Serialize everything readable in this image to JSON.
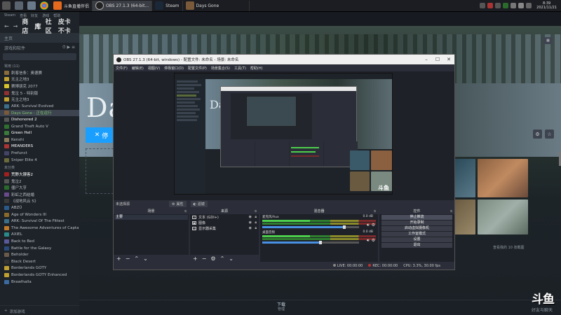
{
  "taskbar": {
    "tasks": [
      {
        "label": "斗鱼直播伴侣",
        "color": "#e56a1d"
      },
      {
        "label": "OBS 27.1.3 (64-bit...",
        "color": "#444",
        "active": true
      },
      {
        "label": "Steam",
        "color": "#1b2838"
      },
      {
        "label": "Days Gone",
        "color": "#7a5a3a"
      }
    ],
    "clock_time": "8:39",
    "clock_date": "2021/11/21"
  },
  "steam": {
    "menu": [
      "Steam",
      "查看",
      "好友",
      "游戏",
      "帮助"
    ],
    "nav": [
      "商店",
      "库",
      "社区",
      "皮卡不卡"
    ],
    "home_label": "主页",
    "filter_label": "游戏和软件",
    "categories": [
      {
        "name": "常用 (11)",
        "games": [
          {
            "name": "刺客信条：奥德赛",
            "color": "#8a6d3b"
          },
          {
            "name": "无主之地3",
            "color": "#c0a030"
          },
          {
            "name": "赛博朋克 2077",
            "color": "#d6c22c"
          },
          {
            "name": "鬼泣 5 - 特别版",
            "color": "#903030"
          },
          {
            "name": "无主之地3",
            "color": "#c0a030"
          },
          {
            "name": "ARK: Survival Evolved",
            "color": "#3c6e8a"
          },
          {
            "name": "Days Gone - 正在运行",
            "color": "#7a5a3a",
            "selected": true
          },
          {
            "name": "Dishonored 2",
            "color": "#555",
            "bright": true
          },
          {
            "name": "Grand Theft Auto V",
            "color": "#2f6e2f"
          },
          {
            "name": "Green Hell",
            "color": "#3a7a3a",
            "bright": true
          },
          {
            "name": "Kenshi",
            "color": "#8a7a5a"
          },
          {
            "name": "MEANDERS",
            "color": "#a33",
            "bright": true
          },
          {
            "name": "Prefunct",
            "color": "#446"
          },
          {
            "name": "Sniper Elite 4",
            "color": "#6a6a3a"
          }
        ]
      },
      {
        "name": "未分类",
        "games": [
          {
            "name": "荒野大镖客2",
            "color": "#a02020",
            "bright": true
          },
          {
            "name": "鬼泣2",
            "color": "#555"
          },
          {
            "name": "僵尸大亨",
            "color": "#2a6a2a"
          },
          {
            "name": "彩虹之西结婚",
            "color": "#6a4a8a"
          },
          {
            "name": "《战地风云 5》",
            "color": "#3a3a3a"
          },
          {
            "name": "ABZÛ",
            "color": "#2a5a8a"
          },
          {
            "name": "Age of Wonders III",
            "color": "#8a6a2a"
          },
          {
            "name": "ARK: Survival Of The Fittest",
            "color": "#3c6e8a"
          },
          {
            "name": "The Awesome Adventures of Capta",
            "color": "#c07a2a"
          },
          {
            "name": "AXIEL",
            "color": "#2a8a8a"
          },
          {
            "name": "Back to Bed",
            "color": "#5a5a9a"
          },
          {
            "name": "Battle for the Galaxy",
            "color": "#2a4a7a"
          },
          {
            "name": "Beholder",
            "color": "#6a5a4a"
          },
          {
            "name": "Black Desert",
            "color": "#333"
          },
          {
            "name": "Borderlands GOTY",
            "color": "#c0a030"
          },
          {
            "name": "Borderlands GOTY Enhanced",
            "color": "#c0a030"
          },
          {
            "name": "Brawlhalla",
            "color": "#3a6aa0"
          }
        ]
      }
    ],
    "add_game": "添加游戏",
    "game_title": "Da",
    "play_label": "停",
    "screenshot_label": "查看我的 10 张截图",
    "download_label": "下载",
    "download_sub": "管理",
    "friends_label": "好友与聊天"
  },
  "obs": {
    "title": "OBS 27.1.3 (64-bit, windows) - 配置文件: 未命名 - 场景: 未命名",
    "menu": [
      "文件(F)",
      "编辑(E)",
      "视图(V)",
      "停靠窗口(D)",
      "配置文件(P)",
      "场景集合(S)",
      "工具(T)",
      "帮助(H)"
    ],
    "source_bar": {
      "none_selected": "未选择源",
      "props": "属性",
      "filters": "滤镜"
    },
    "docks": {
      "scenes_title": "场景",
      "sources_title": "来源",
      "mixer_title": "混音器",
      "controls_title": "控件"
    },
    "scenes": [
      "主要"
    ],
    "sources": [
      {
        "name": "文本 (GDI+)",
        "icon": "T"
      },
      {
        "name": "图像",
        "icon": "▣"
      },
      {
        "name": "显示器采集",
        "icon": "▭"
      }
    ],
    "mixer": [
      {
        "name": "麦克风/Aux",
        "db": "0.0 dB",
        "level": 0.42,
        "volume": 0.85
      },
      {
        "name": "桌面音频",
        "db": "0.0 dB",
        "level": 0.3,
        "volume": 0.6
      }
    ],
    "controls": [
      "停止推流",
      "开始录制",
      "启动虚拟摄像机",
      "工作室模式",
      "设置",
      "退出"
    ],
    "status": {
      "live": "LIVE: 00:00:00",
      "rec": "REC: 00:00:00",
      "cpu": "CPU: 3.3%, 30.00 fps"
    },
    "preview_title": "Da",
    "watermark": "斗鱼"
  },
  "douyu_logo": "斗鱼"
}
